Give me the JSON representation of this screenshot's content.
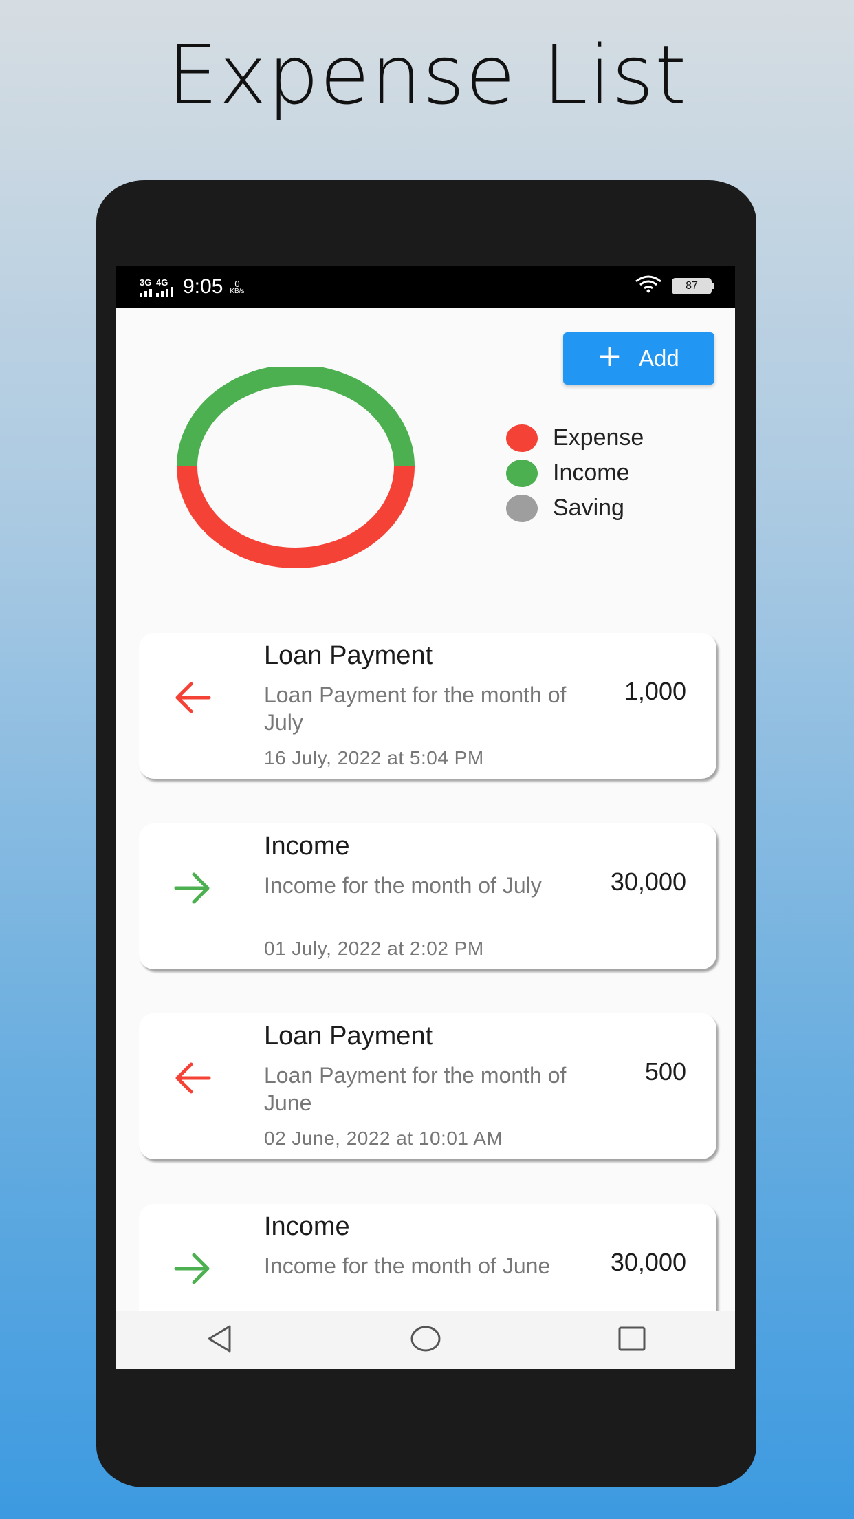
{
  "promo": {
    "title": "Expense List"
  },
  "status_bar": {
    "net1": "3G",
    "net2": "4G",
    "time": "9:05",
    "speed_value": "0",
    "speed_unit": "KB/s",
    "battery": "87"
  },
  "toolbar": {
    "add_label": "Add",
    "add_icon": "plus-icon"
  },
  "chart_data": {
    "type": "pie",
    "title": "",
    "series": [
      {
        "name": "Expense",
        "value": 50,
        "color": "#f44336"
      },
      {
        "name": "Income",
        "value": 50,
        "color": "#4caf50"
      },
      {
        "name": "Saving",
        "value": 0,
        "color": "#9e9e9e"
      }
    ],
    "legend_position": "right",
    "style": "donut"
  },
  "legend": [
    {
      "label": "Expense",
      "color": "#f44336"
    },
    {
      "label": "Income",
      "color": "#4caf50"
    },
    {
      "label": "Saving",
      "color": "#9e9e9e"
    }
  ],
  "transactions": [
    {
      "title": "Loan Payment",
      "description": "Loan Payment for the month of July",
      "date": "16 July, 2022 at 5:04 PM",
      "amount": "1,000",
      "direction": "out",
      "icon": "arrow-left-icon",
      "icon_color": "#f44336"
    },
    {
      "title": "Income",
      "description": "Income for the month of July",
      "date": "01 July, 2022 at 2:02 PM",
      "amount": "30,000",
      "direction": "in",
      "icon": "arrow-right-icon",
      "icon_color": "#4caf50"
    },
    {
      "title": "Loan Payment",
      "description": "Loan Payment for the month of June",
      "date": "02 June, 2022 at 10:01 AM",
      "amount": "500",
      "direction": "out",
      "icon": "arrow-left-icon",
      "icon_color": "#f44336"
    },
    {
      "title": "Income",
      "description": "Income for the month of June",
      "date": "",
      "amount": "30,000",
      "direction": "in",
      "icon": "arrow-right-icon",
      "icon_color": "#4caf50"
    }
  ],
  "nav_bar": {
    "back_icon": "back-triangle-icon",
    "home_icon": "home-circle-icon",
    "recents_icon": "recents-square-icon"
  }
}
